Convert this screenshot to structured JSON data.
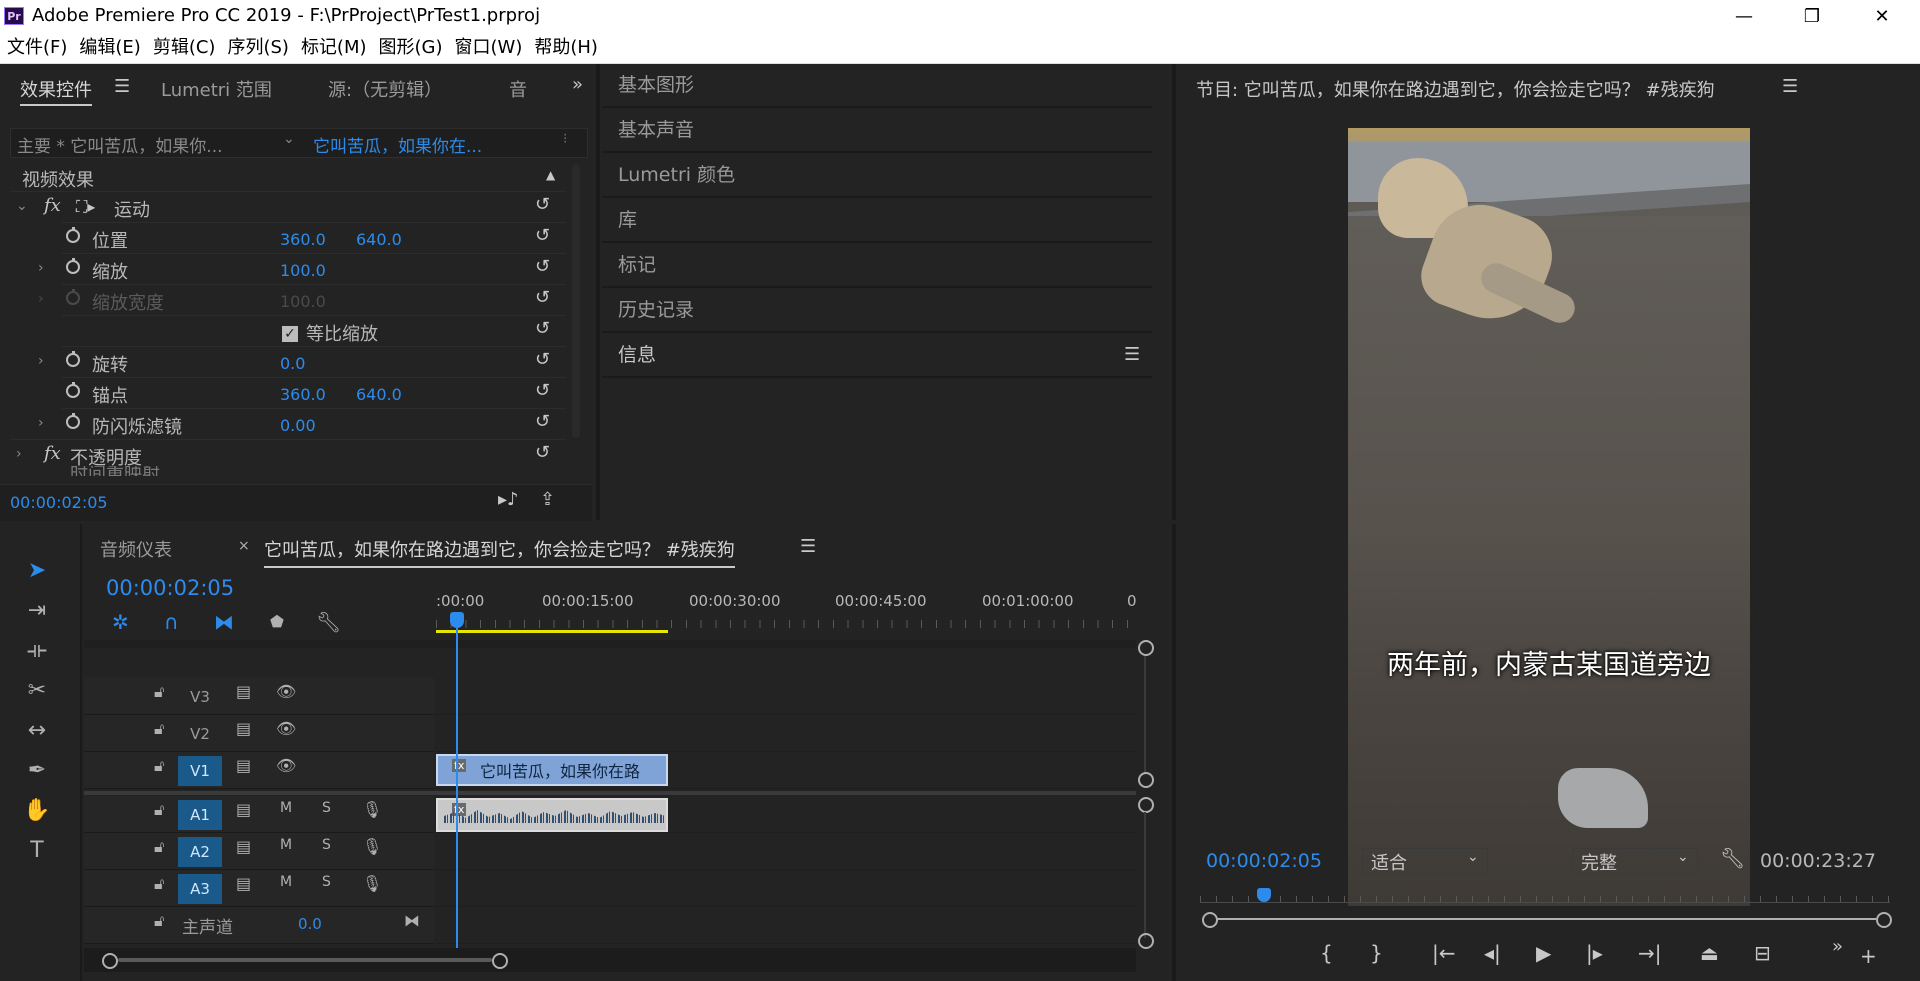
{
  "window": {
    "title": "Adobe Premiere Pro CC 2019 - F:\\PrProject\\PrTest1.prproj",
    "logo": "Pr",
    "minimize": "—",
    "maximize": "❐",
    "close": "✕"
  },
  "menu": [
    "文件(F)",
    "编辑(E)",
    "剪辑(C)",
    "序列(S)",
    "标记(M)",
    "图形(G)",
    "窗口(W)",
    "帮助(H)"
  ],
  "effect_panel": {
    "tabs": [
      "效果控件",
      "Lumetri 范围",
      "源:（无剪辑）",
      "音"
    ],
    "clip_master": "主要 * 它叫苦瓜，如果你...",
    "clip_sequence": "它叫苦瓜，如果你在...",
    "section_video": "视频效果",
    "motion": "运动",
    "position": {
      "label": "位置",
      "x": "360.0",
      "y": "640.0"
    },
    "scale": {
      "label": "缩放",
      "value": "100.0"
    },
    "scale_width": {
      "label": "缩放宽度",
      "value": "100.0"
    },
    "uniform_scale": {
      "label": "等比缩放",
      "checked": true
    },
    "rotation": {
      "label": "旋转",
      "value": "0.0"
    },
    "anchor": {
      "label": "锚点",
      "x": "360.0",
      "y": "640.0"
    },
    "antiflicker": {
      "label": "防闪烁滤镜",
      "value": "0.00"
    },
    "opacity": "不透明度",
    "time_remap": "时间重映射",
    "timecode": "00:00:02:05"
  },
  "panel_stack": [
    "基本图形",
    "基本声音",
    "Lumetri 颜色",
    "库",
    "标记",
    "历史记录",
    "信息"
  ],
  "program_monitor": {
    "title": "节目: 它叫苦瓜，如果你在路边遇到它，你会捡走它吗？ #残疾狗",
    "subtitle": "两年前，内蒙古某国道旁边",
    "timecode": "00:00:02:05",
    "fit": "适合",
    "quality": "完整",
    "duration": "00:00:23:27",
    "playhead_fraction": 0.093
  },
  "timeline": {
    "tab_audio": "音频仪表",
    "tab_sequence": "它叫苦瓜，如果你在路边遇到它，你会捡走它吗？ #残疾狗",
    "timecode": "00:00:02:05",
    "ruler": [
      ":00:00",
      "00:00:15:00",
      "00:00:30:00",
      "00:00:45:00",
      "00:01:00:00",
      "0"
    ],
    "tracks": [
      "V3",
      "V2",
      "V1",
      "A1",
      "A2",
      "A3"
    ],
    "master_label": "主声道",
    "master_value": "0.0",
    "clip_video": "它叫苦瓜，如果你在路",
    "fx_badge": "fx",
    "mute": "M",
    "solo": "S"
  },
  "colors": {
    "accent": "#2d8ceb",
    "work_area": "#e6e600",
    "clip_video": "#7fa3d6",
    "track_on": "#1a5a8a"
  }
}
